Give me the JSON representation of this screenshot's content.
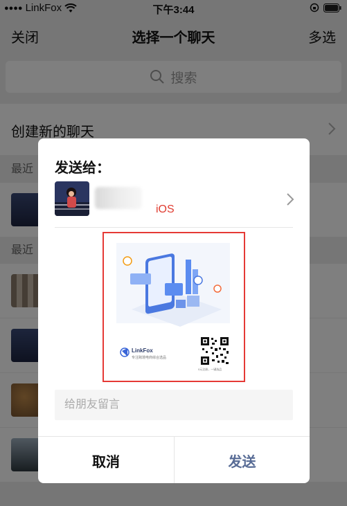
{
  "status_bar": {
    "carrier": "LinkFox",
    "time": "下午3:44"
  },
  "nav": {
    "close": "关闭",
    "title": "选择一个聊天",
    "multi_select": "多选"
  },
  "search": {
    "placeholder": "搜索"
  },
  "create_chat": {
    "label": "创建新的聊天"
  },
  "sections": {
    "recent_1": "最近",
    "recent_2": "最近"
  },
  "dialog": {
    "send_to": "发送给：",
    "recipient_tag": "iOS",
    "preview": {
      "brand": "LinkFox",
      "slogan": "专注跨境电商综合选品",
      "qr_caption": "0元注册，一键选品"
    },
    "message_placeholder": "给朋友留言",
    "cancel": "取消",
    "send": "发送"
  },
  "colors": {
    "send_button": "#576b95",
    "annotation_red": "#e53935"
  }
}
